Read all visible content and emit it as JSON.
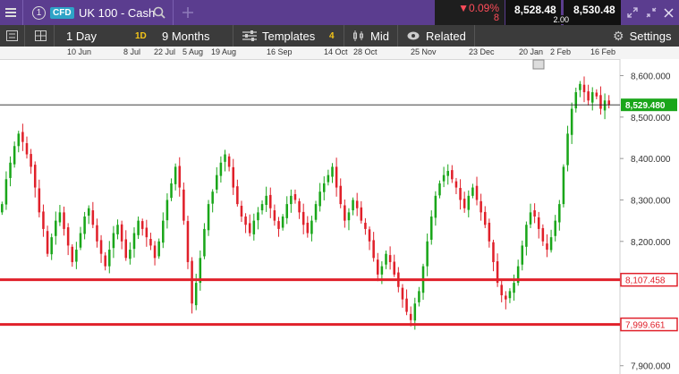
{
  "header": {
    "panel_number": "1",
    "instrument_type": "CFD",
    "instrument_name": "UK 100 - Cash",
    "change_percent": "▼0.09%",
    "change_points": "8",
    "sell_price": "8,528.48",
    "spread": "2.00",
    "buy_price": "8,530.48"
  },
  "toolbar": {
    "timeframe_label": "1 Day",
    "timeframe_badge": "1D",
    "period_label": "9 Months",
    "templates_label": "Templates",
    "templates_count": "4",
    "price_mode_label": "Mid",
    "related_label": "Related",
    "settings_label": "Settings"
  },
  "date_axis": [
    "10 Jun",
    "8 Jul",
    "22 Jul",
    "5 Aug",
    "19 Aug",
    "16 Sep",
    "14 Oct",
    "28 Oct",
    "25 Nov",
    "23 Dec",
    "20 Jan",
    "2 Feb",
    "16 Feb"
  ],
  "chart_data": {
    "type": "candlestick",
    "instrument": "UK 100 - Cash",
    "y_ticks": [
      "8,600.000",
      "8,500.000",
      "8,400.000",
      "8,300.000",
      "8,200.000",
      "7,900.000"
    ],
    "ylim": [
      7880,
      8640
    ],
    "current_price": "8,529.480",
    "current_price_value": 8529.48,
    "horizontal_levels": [
      {
        "label": "8,107.458",
        "value": 8107.458
      },
      {
        "label": "7,999.661",
        "value": 7999.661
      }
    ],
    "colors": {
      "up": "#1aa61a",
      "down": "#e0202a",
      "level": "#e0202a",
      "current": "#1aa61a"
    },
    "closes": [
      8290,
      8350,
      8390,
      8430,
      8460,
      8440,
      8410,
      8380,
      8330,
      8270,
      8230,
      8170,
      8210,
      8250,
      8270,
      8230,
      8190,
      8150,
      8180,
      8220,
      8260,
      8280,
      8240,
      8200,
      8170,
      8140,
      8180,
      8220,
      8240,
      8200,
      8160,
      8180,
      8220,
      8250,
      8230,
      8210,
      8190,
      8160,
      8200,
      8250,
      8300,
      8340,
      8380,
      8330,
      8250,
      8150,
      8050,
      8100,
      8160,
      8230,
      8290,
      8320,
      8360,
      8390,
      8410,
      8380,
      8330,
      8290,
      8260,
      8240,
      8220,
      8250,
      8270,
      8290,
      8310,
      8280,
      8250,
      8230,
      8260,
      8290,
      8310,
      8300,
      8270,
      8240,
      8220,
      8250,
      8290,
      8320,
      8340,
      8360,
      8380,
      8330,
      8290,
      8250,
      8270,
      8300,
      8280,
      8250,
      8230,
      8200,
      8160,
      8120,
      8140,
      8170,
      8150,
      8120,
      8090,
      8060,
      8030,
      8010,
      8050,
      8080,
      8140,
      8200,
      8260,
      8310,
      8340,
      8360,
      8370,
      8350,
      8330,
      8300,
      8280,
      8310,
      8330,
      8300,
      8270,
      8240,
      8200,
      8150,
      8100,
      8070,
      8060,
      8080,
      8100,
      8140,
      8190,
      8240,
      8270,
      8260,
      8230,
      8200,
      8180,
      8210,
      8250,
      8290,
      8380,
      8460,
      8520,
      8560,
      8580,
      8560,
      8540,
      8560,
      8550,
      8520,
      8540,
      8530
    ]
  }
}
